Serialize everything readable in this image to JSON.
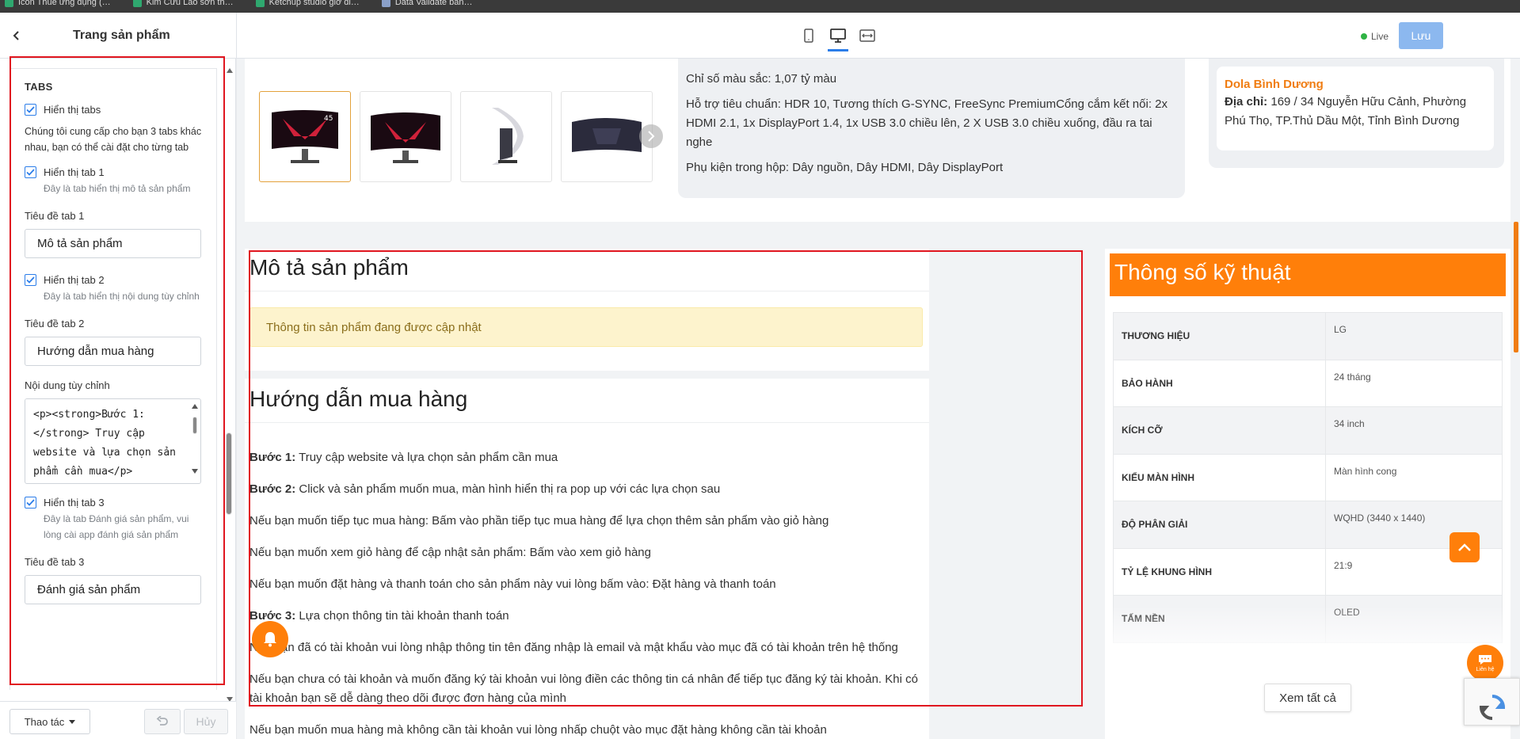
{
  "browser_bookmarks": [
    "Icon Thuê ứng dụng (…",
    "Kim Cửu Lao sơn th…",
    "Ketchup studio giờ đi…",
    "Data Validate bản…"
  ],
  "header": {
    "page_title": "Trang sản phẩm",
    "live_label": "Live",
    "save_label": "Lưu"
  },
  "settings": {
    "section_title": "TABS",
    "show_tabs_label": "Hiển thị tabs",
    "tabs_help": "Chúng tôi cung cấp cho bạn 3 tabs khác nhau, bạn có thể cài đặt cho từng tab",
    "tab1": {
      "show_label": "Hiển thị tab 1",
      "help": "Đây là tab hiển thị mô tả sản phẩm",
      "title_label": "Tiêu đề tab 1",
      "title_value": "Mô tả sản phẩm"
    },
    "tab2": {
      "show_label": "Hiển thị tab 2",
      "help": "Đây là tab hiển thị nội dung tùy chỉnh",
      "title_label": "Tiêu đề tab 2",
      "title_value": "Hướng dẫn mua hàng",
      "content_label": "Nội dung tùy chỉnh",
      "content_value": "<p><strong>Bước 1:</strong> Truy cập website và lựa chọn sản phẩm cần mua</p>"
    },
    "tab3": {
      "show_label": "Hiển thị tab 3",
      "help": "Đây là tab Đánh giá sản phẩm, vui lòng cài app đánh giá sản phẩm",
      "title_label": "Tiêu đề tab 3",
      "title_value": "Đánh giá sản phẩm"
    }
  },
  "footer": {
    "action_label": "Thao tác",
    "cancel_label": "Hủy"
  },
  "product": {
    "specs_lines": [
      "Chỉ số màu sắc: 1,07 tỷ màu",
      "Hỗ trợ tiêu chuẩn: HDR 10, Tương thích G-SYNC, FreeSync PremiumCổng cắm kết nối: 2x HDMI 2.1, 1x DisplayPort 1.4, 1x USB 3.0 chiều lên, 2 X USB 3.0 chiều xuống, đầu ra tai nghe",
      "Phụ kiện trong hộp: Dây nguồn, Dây HDMI, Dây DisplayPort"
    ],
    "store": {
      "name": "Dola Bình Dương",
      "address_label": "Địa chỉ:",
      "address": " 169 / 34 Nguyễn Hữu Cảnh, Phường Phú Thọ, TP.Thủ Dầu Một, Tỉnh Bình Dương"
    }
  },
  "tabs_preview": {
    "description_title": "Mô tả sản phẩm",
    "description_notice": "Thông tin sản phẩm đang được cập nhật",
    "guide_title": "Hướng dẫn mua hàng",
    "guide_steps": [
      {
        "bold": "Bước 1:",
        "text": " Truy cập website và lựa chọn sản phẩm cần mua"
      },
      {
        "bold": "Bước 2:",
        "text": " Click và sản phẩm muốn mua, màn hình hiển thị ra pop up với các lựa chọn sau"
      },
      {
        "bold": "",
        "text": "Nếu bạn muốn tiếp tục mua hàng: Bấm vào phần tiếp tục mua hàng để lựa chọn thêm sản phẩm vào giỏ hàng"
      },
      {
        "bold": "",
        "text": "Nếu bạn muốn xem giỏ hàng để cập nhật sản phẩm: Bấm vào xem giỏ hàng"
      },
      {
        "bold": "",
        "text": "Nếu bạn muốn đặt hàng và thanh toán cho sản phẩm này vui lòng bấm vào: Đặt hàng và thanh toán"
      },
      {
        "bold": "Bước 3:",
        "text": " Lựa chọn thông tin tài khoản thanh toán"
      },
      {
        "bold": "",
        "text": "Nếu bạn đã có tài khoản vui lòng nhập thông tin tên đăng nhập là email và mật khẩu vào mục đã có tài khoản trên hệ thống"
      },
      {
        "bold": "",
        "text": "Nếu bạn chưa có tài khoản và muốn đăng ký tài khoản vui lòng điền các thông tin cá nhân để tiếp tục đăng ký tài khoản. Khi có tài khoản bạn sẽ dễ dàng theo dõi được đơn hàng của mình"
      },
      {
        "bold": "",
        "text": "Nếu bạn muốn mua hàng mà không cần tài khoản vui lòng nhấp chuột vào mục đặt hàng không cần tài khoản"
      }
    ]
  },
  "spec_panel": {
    "title": "Thông số kỹ thuật",
    "rows": [
      {
        "key": "Thương hiệu",
        "value": "LG"
      },
      {
        "key": "Bảo hành",
        "value": "24 tháng"
      },
      {
        "key": "Kích cỡ",
        "value": "34 inch"
      },
      {
        "key": "Kiểu màn hình",
        "value": "Màn hình cong"
      },
      {
        "key": "Độ phân giải",
        "value": "WQHD (3440 x 1440)"
      },
      {
        "key": "Tỷ lệ khung hình",
        "value": "21:9"
      },
      {
        "key": "Tấm nền",
        "value": "OLED"
      }
    ],
    "see_all_label": "Xem tất cả"
  },
  "floating": {
    "contact_label": "Liên hệ"
  },
  "colors": {
    "accent_orange": "#ff7f0a",
    "primary_blue": "#2b7de9",
    "highlight_red": "#e0161f",
    "live_green": "#2fb344"
  }
}
